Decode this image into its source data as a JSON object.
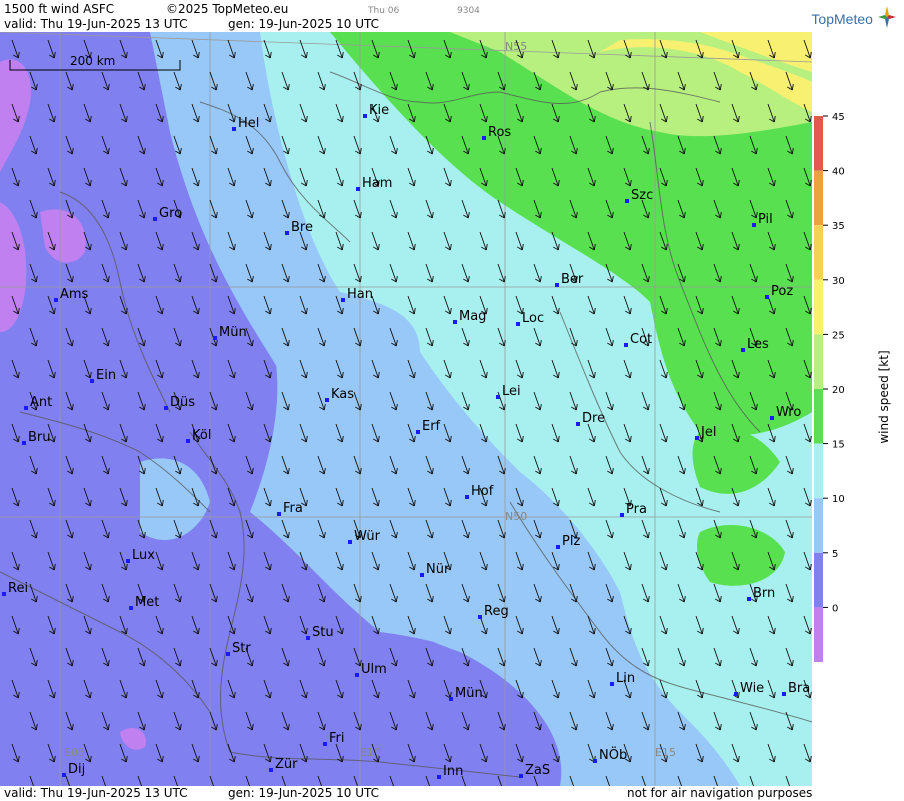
{
  "header": {
    "title": "1500 ft wind ASFC",
    "copyright": "©2025 TopMeteo.eu",
    "day_small": "Thu 06",
    "code_small": "9304",
    "valid": "valid:  Thu  19-Jun-2025  13 UTC",
    "generated": "gen: 19-Jun-2025 10 UTC",
    "logo": "TopMeteo"
  },
  "footer": {
    "valid": "valid:  Thu  19-Jun-2025  13 UTC",
    "generated": "gen: 19-Jun-2025 10 UTC",
    "disclaimer": "not for air navigation purposes"
  },
  "map": {
    "scale_label": "200 km",
    "grid_labels": [
      "N55",
      "N50",
      "E05",
      "E10",
      "E15"
    ],
    "cities": [
      "Kie",
      "Hel",
      "Ros",
      "Ham",
      "Gro",
      "Bre",
      "Szc",
      "Pil",
      "Ber",
      "Poz",
      "Ams",
      "Han",
      "Mag",
      "Loc",
      "Cot",
      "Mün",
      "Les",
      "Ein",
      "Kas",
      "Lei",
      "Wro",
      "Ant",
      "Düs",
      "Dre",
      "Erf",
      "Bru",
      "Köl",
      "Jel",
      "Hof",
      "Fra",
      "Pra",
      "N50",
      "Würz",
      "Plz",
      "Lux",
      "Nür",
      "Rei",
      "Met",
      "Brn",
      "Reg",
      "Stu",
      "Str",
      "Lin",
      "Ulm",
      "Wie",
      "Bra",
      "Mün2",
      "Fri",
      "Nöb",
      "Dij",
      "Zür",
      "Inn",
      "ZaS"
    ],
    "city_labels": {
      "Kie": "Kie",
      "Hel": "Hel",
      "Ros": "Ros",
      "Ham": "Ham",
      "Gro": "Gro",
      "Bre": "Bre",
      "Szc": "Szc",
      "Pil": "Pil",
      "Ber": "Ber",
      "Poz": "Poz",
      "Ams": "Ams",
      "Han": "Han",
      "Mag": "Mag",
      "Loc": "Loc",
      "Cot": "Cot",
      "Mün": "Mün",
      "Les": "Les",
      "Ein": "Ein",
      "Kas": "Kas",
      "Lei": "Lei",
      "Wro": "Wro",
      "Ant": "Ant",
      "Düs": "Düs",
      "Dre": "Dre",
      "Erf": "Erf",
      "Bru": "Bru",
      "Köl": "Köl",
      "Jel": "Jel",
      "Hof": "Hof",
      "Fra": "Fra",
      "Pra": "Pra",
      "Würz": "Wür",
      "Plz": "Plz",
      "Lux": "Lux",
      "Nür": "Nür",
      "Rei": "Rei",
      "Met": "Met",
      "Brn": "Brn",
      "Reg": "Reg",
      "Stu": "Stu",
      "Str": "Str",
      "Lin": "Lin",
      "Ulm": "Ulm",
      "Wie": "Wie",
      "Bra": "Bra",
      "Mün2": "Mün",
      "Fri": "Fri",
      "Nöb": "NÖb",
      "Dij": "Dij",
      "Zür": "Zür",
      "Inn": "Inn",
      "ZaS": "ZaS"
    },
    "wind_direction": "north-west to south-east"
  },
  "legend": {
    "axis_label": "wind speed [kt]",
    "ticks": [
      "45",
      "40",
      "35",
      "30",
      "25",
      "20",
      "15",
      "10",
      "5",
      "0"
    ],
    "colors": [
      "#e05b4b",
      "#f0a040",
      "#f8d058",
      "#f8f070",
      "#b8f080",
      "#58e050",
      "#a8f0f0",
      "#98c8f8",
      "#8080f0",
      "#c080f0"
    ],
    "units": "kt"
  }
}
